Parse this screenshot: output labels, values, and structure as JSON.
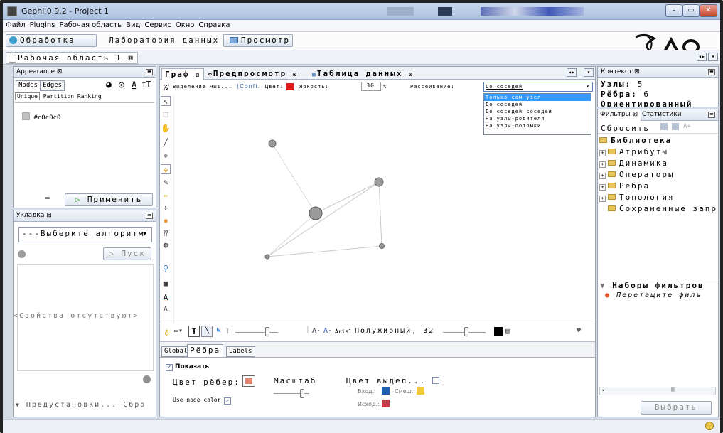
{
  "window": {
    "title": "Gephi 0.9.2 - Project 1",
    "min": "–",
    "max": "▭",
    "close": "✕"
  },
  "menu": [
    "Файл",
    "Plugins",
    "Рабочая область",
    "Вид",
    "Сервис",
    "Окно",
    "Справка"
  ],
  "toolbar": {
    "overview": "Обработка",
    "data_lab": "Лаборатория данных",
    "preview": "Просмотр"
  },
  "workspace": {
    "tab": "Рабочая область 1 ⊠"
  },
  "appearance": {
    "title": "Appearance ⊠",
    "tab_nodes": "Nodes",
    "tab_edges": "Edges",
    "sub_unique": "Unique",
    "sub_partition": "Partition",
    "sub_ranking": "Ranking",
    "color_value": "#c0c0c0",
    "color_hex": "#c0c0c0",
    "apply": "Применить",
    "icon_color": "palette-icon",
    "icon_size": "size-icon",
    "icon_label_color": "A",
    "icon_label_size": "тT"
  },
  "layout": {
    "title": "Укладка ⊠",
    "select": "---Выберите алгоритм",
    "run": "Пуск",
    "no_props": "<Свойства отсутствуют>",
    "presets": "Предустановки...",
    "reset": "Сбро"
  },
  "graph_tabs": {
    "graph": "Граф",
    "preview": "Предпросмотр",
    "table": "Таблица данных",
    "close": "⊠"
  },
  "graph_bar": {
    "mouse_sel": "Выделение мыш...",
    "config": "(Confi.",
    "color": "Цвет:",
    "brightness": "Яркость:",
    "brightness_value": "30",
    "percent": "%",
    "rasseivanie": "Рассеивание:",
    "scatter_selected": "До соседей"
  },
  "scatter_options": [
    "Только сам узел",
    "До соседей",
    "До соседей соседей",
    "На узлы-родителя",
    "На узлы-потомки"
  ],
  "colors": {
    "node": "#999999",
    "edge": "#bbbbbb",
    "red": "#e21b1b",
    "blue": "#1f5fb0",
    "yellow": "#f0c93c",
    "crimson": "#c43b4a",
    "edge_swatch": "#e8846f"
  },
  "bottom_toolbar": {
    "font": "Arial",
    "font_label": "Полужирный, 32"
  },
  "props": {
    "tab_global": "Global",
    "tab_edges": "Рёбра",
    "tab_labels": "Labels",
    "show": "Показать",
    "edge_color": "Цвет рёбер:",
    "scale": "Масштаб",
    "highlight": "Цвет выдел...",
    "use_node_color": "Use node color",
    "in": "Вход.:",
    "mixed": "Смеш.:",
    "out": "Исход.:"
  },
  "context": {
    "title": "Контекст ⊠",
    "nodes_label": "Узлы:",
    "nodes_value": "5",
    "edges_label": "Рёбра:",
    "edges_value": "6",
    "directed": "Ориентированный"
  },
  "filters": {
    "tab_filters": "Фильтры ⊠",
    "tab_stats": "Статистики",
    "reset": "Сбросить",
    "library": "Библиотека",
    "items": [
      "Атрибуты",
      "Динамика",
      "Операторы",
      "Рёбра",
      "Топология",
      "Сохраненные запр"
    ],
    "queries": "Наборы фильтров",
    "drag": "Перетащите филь",
    "select": "Выбрать"
  }
}
